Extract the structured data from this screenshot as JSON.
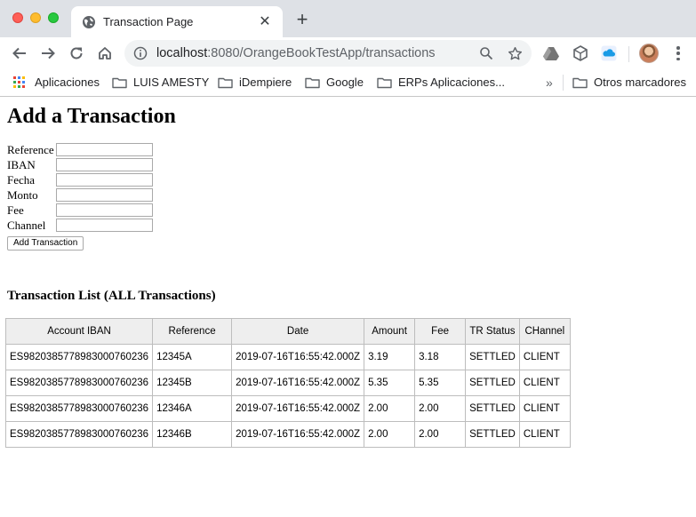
{
  "browser": {
    "tab_title": "Transaction Page",
    "url_host": "localhost",
    "url_rest": ":8080/OrangeBookTestApp/transactions",
    "bookmarks": [
      "Aplicaciones",
      "LUIS AMESTY",
      "iDempiere",
      "Google",
      "ERPs Aplicaciones..."
    ],
    "overflow": "»",
    "other_bookmarks": "Otros marcadores",
    "colors": {
      "tabstrip": "#dee1e6",
      "omnibox": "#f1f3f4"
    }
  },
  "page": {
    "title": "Add a Transaction",
    "form": {
      "fields": [
        "Reference",
        "IBAN",
        "Fecha",
        "Monto",
        "Fee",
        "Channel"
      ],
      "submit_label": "Add Transaction"
    },
    "list_title": "Transaction List (ALL Transactions)",
    "table": {
      "headers": [
        "Account IBAN",
        "Reference",
        "Date",
        "Amount",
        "Fee",
        "TR Status",
        "CHannel"
      ],
      "rows": [
        [
          "ES9820385778983000760236",
          "12345A",
          "2019-07-16T16:55:42.000Z",
          "3.19",
          "3.18",
          "SETTLED",
          "CLIENT"
        ],
        [
          "ES9820385778983000760236",
          "12345B",
          "2019-07-16T16:55:42.000Z",
          "5.35",
          "5.35",
          "SETTLED",
          "CLIENT"
        ],
        [
          "ES9820385778983000760236",
          "12346A",
          "2019-07-16T16:55:42.000Z",
          "2.00",
          "2.00",
          "SETTLED",
          "CLIENT"
        ],
        [
          "ES9820385778983000760236",
          "12346B",
          "2019-07-16T16:55:42.000Z",
          "2.00",
          "2.00",
          "SETTLED",
          "CLIENT"
        ]
      ]
    }
  }
}
